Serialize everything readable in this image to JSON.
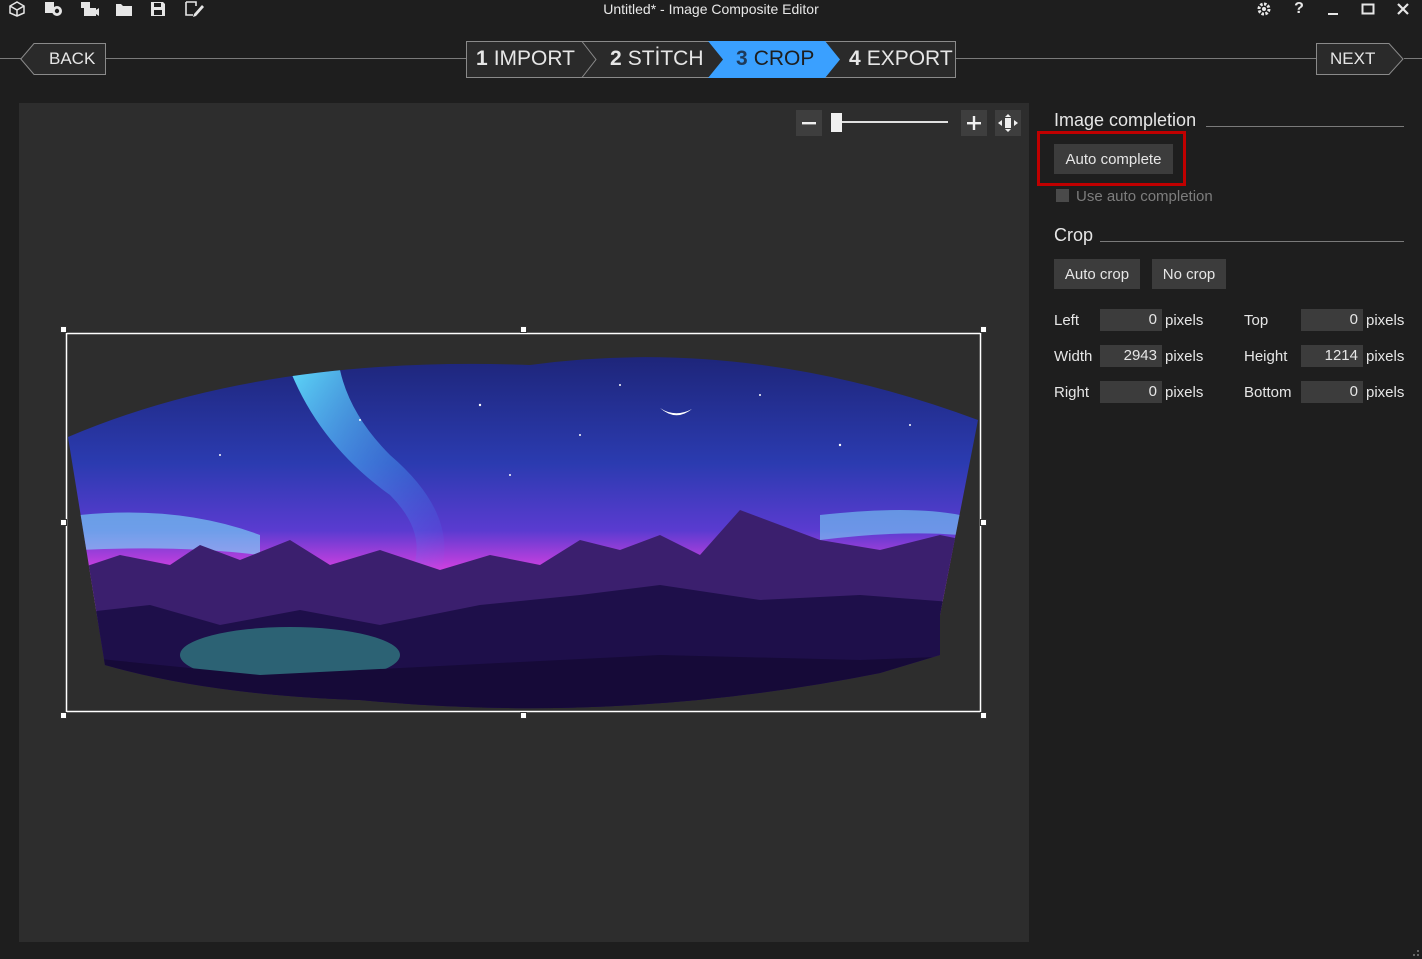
{
  "window": {
    "title": "Untitled* - Image Composite Editor",
    "quick_access_icons": [
      "new-panorama-icon",
      "new-video-panorama-icon",
      "new-video-icon",
      "open-project-icon",
      "save-project-icon",
      "save-as-icon"
    ],
    "controls": [
      "settings-icon",
      "help-icon",
      "minimize-icon",
      "maximize-icon",
      "close-icon"
    ]
  },
  "nav": {
    "back_label": "BACK",
    "next_label": "NEXT",
    "steps": [
      {
        "num": "1",
        "label": "IMPORT",
        "active": false
      },
      {
        "num": "2",
        "label": "STİTCH",
        "active": false
      },
      {
        "num": "3",
        "label": "CROP",
        "active": true
      },
      {
        "num": "4",
        "label": "EXPORT",
        "active": false
      }
    ],
    "active_color": "#3aa0ff"
  },
  "zoom": {
    "level": 0.05,
    "zoom_out_icon": "minus-icon",
    "zoom_in_icon": "plus-icon",
    "fit_icon": "fit-to-window-icon"
  },
  "panel": {
    "image_completion": {
      "title": "Image completion",
      "auto_complete_label": "Auto complete",
      "use_auto_completion_label": "Use auto completion",
      "use_auto_completion_checked": false
    },
    "crop": {
      "title": "Crop",
      "auto_crop_label": "Auto crop",
      "no_crop_label": "No crop",
      "unit": "pixels",
      "left_label": "Left",
      "left_value": "0",
      "top_label": "Top",
      "top_value": "0",
      "width_label": "Width",
      "width_value": "2943",
      "height_label": "Height",
      "height_value": "1214",
      "right_label": "Right",
      "right_value": "0",
      "bottom_label": "Bottom",
      "bottom_value": "0"
    }
  },
  "colors": {
    "highlight": "#c00000",
    "background": "#1e1e1e",
    "canvas": "#2d2d2d"
  }
}
